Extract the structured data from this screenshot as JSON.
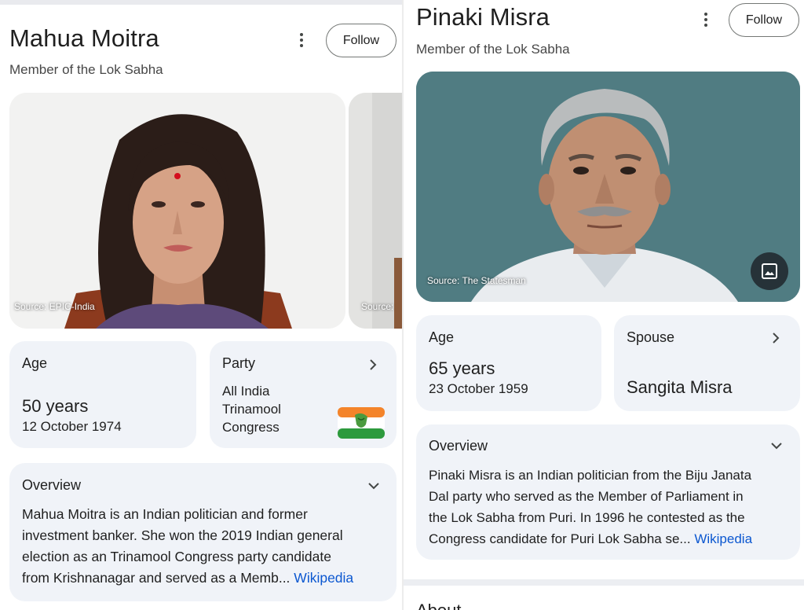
{
  "left": {
    "name": "Mahua Moitra",
    "subtitle": "Member of the Lok Sabha",
    "follow_label": "Follow",
    "photo_source": "Source: EPIC-India",
    "second_photo_source": "Source:",
    "age": {
      "label": "Age",
      "value": "50 years",
      "date": "12 October 1974"
    },
    "party": {
      "label": "Party",
      "lines": [
        "All India",
        "Trinamool",
        "Congress"
      ]
    },
    "overview": {
      "label": "Overview",
      "lines": [
        "Mahua Moitra is an Indian politician and former",
        "investment banker. She won the 2019 Indian general",
        "election as an Trinamool Congress party candidate",
        "from Krishnanagar and served as a Memb..."
      ],
      "link": "Wikipedia"
    }
  },
  "right": {
    "name": "Pinaki Misra",
    "subtitle": "Member of the Lok Sabha",
    "follow_label": "Follow",
    "photo_source": "Source: The Statesman",
    "age": {
      "label": "Age",
      "value": "65 years",
      "date": "23 October 1959"
    },
    "spouse": {
      "label": "Spouse",
      "value": "Sangita Misra"
    },
    "overview": {
      "label": "Overview",
      "lines": [
        "Pinaki Misra is an Indian politician from the Biju Janata",
        "Dal party who served as the Member of Parliament in",
        "the Lok Sabha from Puri. In 1996 he contested as the",
        "Congress candidate for Puri Lok Sabha se..."
      ],
      "link": "Wikipedia"
    },
    "next_heading": "About"
  },
  "colors": {
    "card_bg": "#f0f3f8",
    "link": "#0b57d0",
    "photo_bg_right": "#507a80",
    "photo_bg_left": "#f2f2f2"
  },
  "icons": [
    "kebab-menu-icon",
    "chevron-right-icon",
    "chevron-down-icon",
    "image-icon",
    "party-flag-icon"
  ]
}
